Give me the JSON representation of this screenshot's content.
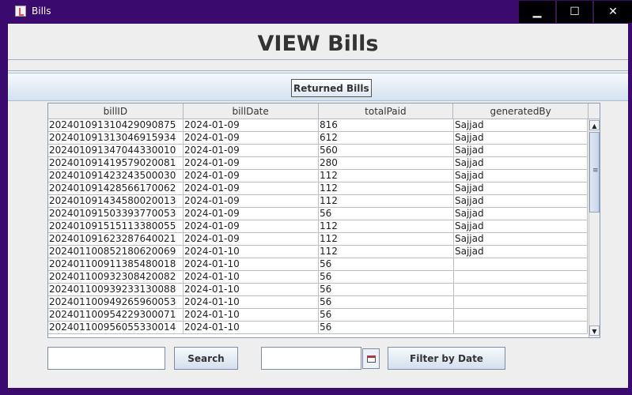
{
  "window": {
    "title": "Bills",
    "minimize_glyph": "▁",
    "maximize_glyph": "☐",
    "close_glyph": "✕"
  },
  "heading": "VIEW Bills",
  "toolbar": {
    "returned_label": "Returned Bills"
  },
  "table": {
    "columns": [
      "billID",
      "billDate",
      "totalPaid",
      "generatedBy"
    ],
    "rows": [
      [
        "202401091310429090875",
        "2024-01-09",
        "816",
        "Sajjad"
      ],
      [
        "202401091313046915934",
        "2024-01-09",
        "612",
        "Sajjad"
      ],
      [
        "202401091347044330010",
        "2024-01-09",
        "560",
        "Sajjad"
      ],
      [
        "202401091419579020081",
        "2024-01-09",
        "280",
        "Sajjad"
      ],
      [
        "202401091423243500030",
        "2024-01-09",
        "112",
        "Sajjad"
      ],
      [
        "202401091428566170062",
        "2024-01-09",
        "112",
        "Sajjad"
      ],
      [
        "202401091434580020013",
        "2024-01-09",
        "112",
        "Sajjad"
      ],
      [
        "202401091503393770053",
        "2024-01-09",
        "56",
        "Sajjad"
      ],
      [
        "202401091515113380055",
        "2024-01-09",
        "112",
        "Sajjad"
      ],
      [
        "202401091623287640021",
        "2024-01-09",
        "112",
        "Sajjad"
      ],
      [
        "202401100852180620069",
        "2024-01-10",
        "112",
        "Sajjad"
      ],
      [
        "202401100911385480018",
        "2024-01-10",
        "56",
        ""
      ],
      [
        "202401100932308420082",
        "2024-01-10",
        "56",
        ""
      ],
      [
        "202401100939233130088",
        "2024-01-10",
        "56",
        ""
      ],
      [
        "202401100949265960053",
        "2024-01-10",
        "56",
        ""
      ],
      [
        "202401100954229300071",
        "2024-01-10",
        "56",
        ""
      ],
      [
        "202401100956055330014",
        "2024-01-10",
        "56",
        ""
      ]
    ],
    "scroll_up_glyph": "▲",
    "scroll_down_glyph": "▼"
  },
  "search": {
    "value": "",
    "button_label": "Search"
  },
  "filter": {
    "date_value": "",
    "button_label": "Filter by Date",
    "calendar_icon": "calendar-icon"
  },
  "colors": {
    "title_bar": "#3a0a6e",
    "panel": "#eeeeee",
    "button_gradient_end": "#d3e0ee"
  }
}
